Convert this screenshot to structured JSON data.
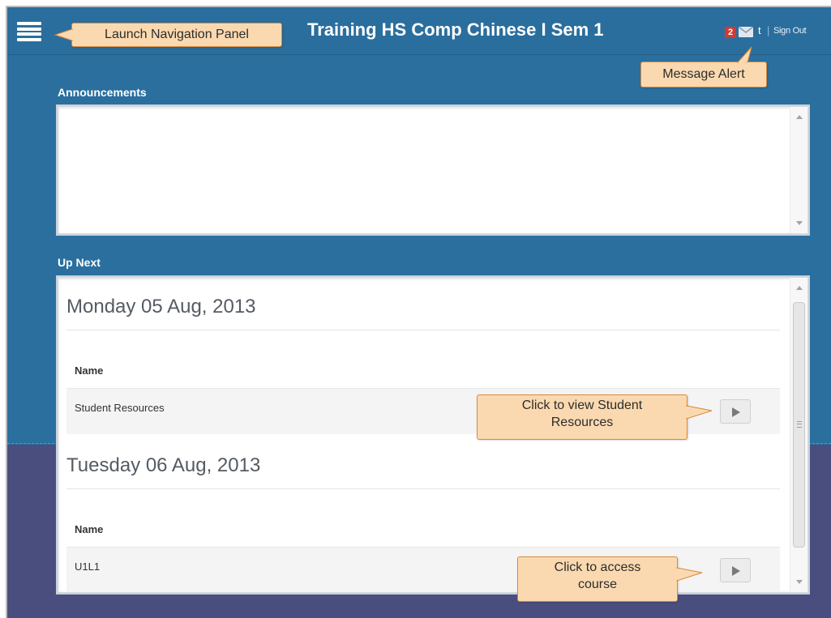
{
  "header": {
    "title": "Training HS Comp Chinese I Sem 1",
    "message_count": "2",
    "user_initial": "t",
    "separator": "|",
    "sign_out": "Sign Out"
  },
  "icons": {
    "menu": "hamburger-menu-icon",
    "messages": "envelope-icon",
    "open": "play-icon"
  },
  "announcements": {
    "title": "Announcements"
  },
  "up_next": {
    "title": "Up Next",
    "days": [
      {
        "date": "Monday 05 Aug, 2013",
        "column_header": "Name",
        "items": [
          {
            "name": "Student Resources"
          }
        ]
      },
      {
        "date": "Tuesday 06 Aug, 2013",
        "column_header": "Name",
        "items": [
          {
            "name": "U1L1"
          }
        ]
      }
    ]
  },
  "callouts": {
    "nav": "Launch Navigation Panel",
    "message": "Message Alert",
    "student_resources": "Click to view Student Resources",
    "access_course": "Click to access course"
  },
  "colors": {
    "header_blue": "#2a6e9d",
    "body_blue": "#2a6f9e",
    "body_purple": "#4a4e7e",
    "badge_red": "#d33a2f",
    "callout_fill": "#fbd9b0",
    "callout_border": "#d8893c"
  }
}
